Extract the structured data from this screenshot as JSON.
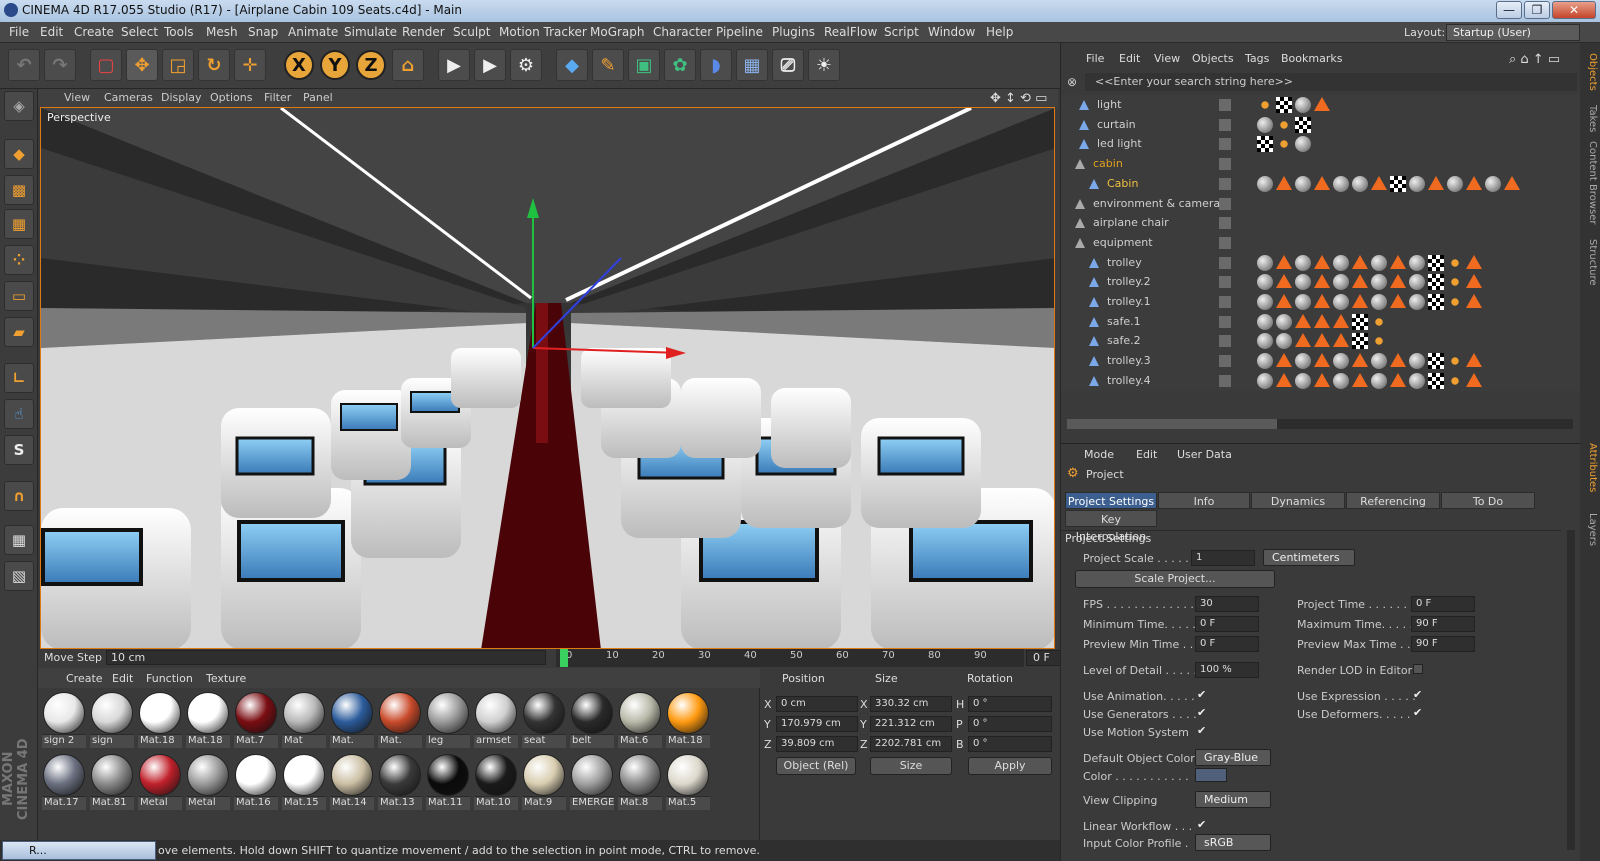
{
  "window": {
    "title": "CINEMA 4D R17.055 Studio (R17) - [Airplane Cabin 109 Seats.c4d] - Main",
    "min": "—",
    "max": "❐",
    "close": "✕"
  },
  "menu": [
    "File",
    "Edit",
    "Create",
    "Select",
    "Tools",
    "Mesh",
    "Snap",
    "Animate",
    "Simulate",
    "Render",
    "Sculpt",
    "Motion Tracker",
    "MoGraph",
    "Character",
    "Pipeline",
    "Plugins",
    "RealFlow",
    "Script",
    "Window",
    "Help"
  ],
  "layout": {
    "label": "Layout:",
    "value": "Startup (User)"
  },
  "toolbar": {
    "x": "X",
    "y": "Y",
    "z": "Z"
  },
  "viewport": {
    "menu": [
      "View",
      "Cameras",
      "Display",
      "Options",
      "Filter",
      "Panel"
    ],
    "label": "Perspective"
  },
  "timeline": {
    "move_step_label": "Move Step",
    "move_step_value": "10 cm",
    "ticks": [
      "0",
      "10",
      "20",
      "30",
      "40",
      "50",
      "60",
      "70",
      "80",
      "90"
    ],
    "current_frame": "0 F"
  },
  "materials": {
    "menu": [
      "Create",
      "Edit",
      "Function",
      "Texture"
    ],
    "row1": [
      {
        "name": "sign 2",
        "color": "#e8e8e8"
      },
      {
        "name": "sign",
        "color": "#d8d8d8"
      },
      {
        "name": "Mat.18",
        "color": "#ffffff"
      },
      {
        "name": "Mat.18",
        "color": "#ffffff"
      },
      {
        "name": "Mat.7",
        "color": "#7a0d12"
      },
      {
        "name": "Mat",
        "color": "#b8b8b8"
      },
      {
        "name": "Mat.",
        "color": "#2c5c9c"
      },
      {
        "name": "Mat.",
        "color": "#c84a2a"
      },
      {
        "name": "leg",
        "color": "#9a9a9a"
      },
      {
        "name": "armset",
        "color": "#cfcfcf"
      },
      {
        "name": "seat",
        "color": "#333333"
      },
      {
        "name": "belt",
        "color": "#2a2a2a"
      },
      {
        "name": "Mat.6",
        "color": "#b9b9a9"
      },
      {
        "name": "Mat.18",
        "color": "#ff9a10"
      }
    ],
    "row2": [
      {
        "name": "Mat.17",
        "color": "#6a7080"
      },
      {
        "name": "Mat.81",
        "color": "#8a8a8a"
      },
      {
        "name": "Metal",
        "color": "#c0202a"
      },
      {
        "name": "Metal",
        "color": "#9a9a9a"
      },
      {
        "name": "Mat.16",
        "color": "#ffffff"
      },
      {
        "name": "Mat.15",
        "color": "#ffffff"
      },
      {
        "name": "Mat.14",
        "color": "#cbbfa4"
      },
      {
        "name": "Mat.13",
        "color": "#3a3a3a"
      },
      {
        "name": "Mat.11",
        "color": "#0a0a0a"
      },
      {
        "name": "Mat.10",
        "color": "#1a1a1a"
      },
      {
        "name": "Mat.9",
        "color": "#d8cdb0"
      },
      {
        "name": "EMERGE",
        "color": "#a0a0a0"
      },
      {
        "name": "Mat.8",
        "color": "#8a8a8a"
      },
      {
        "name": "Mat.5",
        "color": "#dcd8cc"
      }
    ]
  },
  "coords": {
    "headers": [
      "Position",
      "Size",
      "Rotation"
    ],
    "axes": [
      "X",
      "Y",
      "Z"
    ],
    "rot_axes": [
      "H",
      "P",
      "B"
    ],
    "position": [
      "0 cm",
      "170.979 cm",
      "39.809 cm"
    ],
    "size": [
      "330.32 cm",
      "221.312 cm",
      "2202.781 cm"
    ],
    "rotation": [
      "0 °",
      "0 °",
      "0 °"
    ],
    "mode1": "Object (Rel)",
    "mode2": "Size",
    "apply": "Apply"
  },
  "status": {
    "task": "R...",
    "text": "ove elements. Hold down SHIFT to quantize movement / add to the selection in point mode, CTRL to remove."
  },
  "objects": {
    "menu": [
      "File",
      "Edit",
      "View",
      "Objects",
      "Tags",
      "Bookmarks"
    ],
    "search": "<<Enter your search string here>>",
    "rows": [
      {
        "name": "light",
        "indent": 1,
        "color": "#cfcfcf",
        "tags": [
          "dot",
          "chk",
          "sph",
          "tri"
        ]
      },
      {
        "name": "curtain",
        "indent": 1,
        "color": "#cfcfcf",
        "tags": [
          "sph",
          "dot",
          "chk"
        ]
      },
      {
        "name": "led light",
        "indent": 1,
        "color": "#cfcfcf",
        "tags": [
          "chk",
          "dot",
          "sph"
        ]
      },
      {
        "name": "cabin",
        "indent": 0,
        "color": "#e0a020",
        "tags": []
      },
      {
        "name": "Cabin",
        "indent": 2,
        "color": "#f0c040",
        "tags": [
          "sph",
          "tri",
          "sph",
          "tri",
          "sph",
          "sph",
          "tri",
          "chk",
          "sph",
          "tri",
          "sph",
          "tri",
          "sph",
          "tri"
        ]
      },
      {
        "name": "environment & camera",
        "indent": 0,
        "color": "#cfcfcf",
        "tags": []
      },
      {
        "name": "airplane chair",
        "indent": 0,
        "color": "#cfcfcf",
        "tags": []
      },
      {
        "name": "equipment",
        "indent": 0,
        "color": "#cfcfcf",
        "tags": []
      },
      {
        "name": "trolley",
        "indent": 2,
        "color": "#cfcfcf",
        "tags": [
          "sph",
          "tri",
          "sph",
          "tri",
          "sph",
          "tri",
          "sph",
          "tri",
          "sph",
          "chk",
          "dot",
          "tri"
        ]
      },
      {
        "name": "trolley.2",
        "indent": 2,
        "color": "#cfcfcf",
        "tags": [
          "sph",
          "tri",
          "sph",
          "tri",
          "sph",
          "tri",
          "sph",
          "tri",
          "sph",
          "chk",
          "dot",
          "tri"
        ]
      },
      {
        "name": "trolley.1",
        "indent": 2,
        "color": "#cfcfcf",
        "tags": [
          "sph",
          "tri",
          "sph",
          "tri",
          "sph",
          "tri",
          "sph",
          "tri",
          "sph",
          "chk",
          "dot",
          "tri"
        ]
      },
      {
        "name": "safe.1",
        "indent": 2,
        "color": "#cfcfcf",
        "tags": [
          "sph",
          "sph",
          "tri",
          "tri",
          "tri",
          "chk",
          "dot"
        ]
      },
      {
        "name": "safe.2",
        "indent": 2,
        "color": "#cfcfcf",
        "tags": [
          "sph",
          "sph",
          "tri",
          "tri",
          "tri",
          "chk",
          "dot"
        ]
      },
      {
        "name": "trolley.3",
        "indent": 2,
        "color": "#cfcfcf",
        "tags": [
          "sph",
          "tri",
          "sph",
          "tri",
          "sph",
          "tri",
          "sph",
          "tri",
          "sph",
          "chk",
          "dot",
          "tri"
        ]
      },
      {
        "name": "trolley.4",
        "indent": 2,
        "color": "#cfcfcf",
        "tags": [
          "sph",
          "tri",
          "sph",
          "tri",
          "sph",
          "tri",
          "sph",
          "tri",
          "sph",
          "chk",
          "dot",
          "tri"
        ]
      }
    ]
  },
  "attributes": {
    "menu": [
      "Mode",
      "Edit",
      "User Data"
    ],
    "object": "Project",
    "tabs": [
      "Project Settings",
      "Info",
      "Dynamics",
      "Referencing",
      "To Do"
    ],
    "tab2": "Key Interpolation",
    "section": "Project Settings",
    "project_scale_label": "Project Scale . . . . . .",
    "project_scale": "1",
    "scale_unit": "Centimeters",
    "scale_btn": "Scale Project...",
    "fps_label": "FPS . . . . . . . . . . . . . . .",
    "fps": "30",
    "project_time_label": "Project Time . . . . . . . .",
    "project_time": "0 F",
    "min_time_label": "Minimum Time. . . . .",
    "min_time": "0 F",
    "max_time_label": "Maximum Time. . . . .",
    "max_time": "90 F",
    "prev_min_label": "Preview Min Time . .",
    "prev_min": "0 F",
    "prev_max_label": "Preview Max Time . .",
    "prev_max": "90 F",
    "lod_label": "Level of Detail . . . . .",
    "lod": "100 %",
    "render_lod_label": "Render LOD in Editor",
    "use_anim_label": "Use Animation. . . . .",
    "use_expr_label": "Use Expression . . . . .",
    "use_gen_label": "Use Generators . . . .",
    "use_def_label": "Use Deformers. . . . .",
    "use_motion_label": "Use Motion System",
    "def_color_label": "Default Object Color",
    "def_color": "Gray-Blue",
    "color_label": "Color . . . . . . . . . . .",
    "view_clip_label": "View Clipping",
    "view_clip": "Medium",
    "linear_label": "Linear Workflow . . .",
    "icp_label": "Input Color Profile .",
    "icp": "sRGB"
  },
  "sidetabs": [
    "Objects",
    "Takes",
    "Content Browser",
    "Structure",
    "Attributes",
    "Layers"
  ]
}
